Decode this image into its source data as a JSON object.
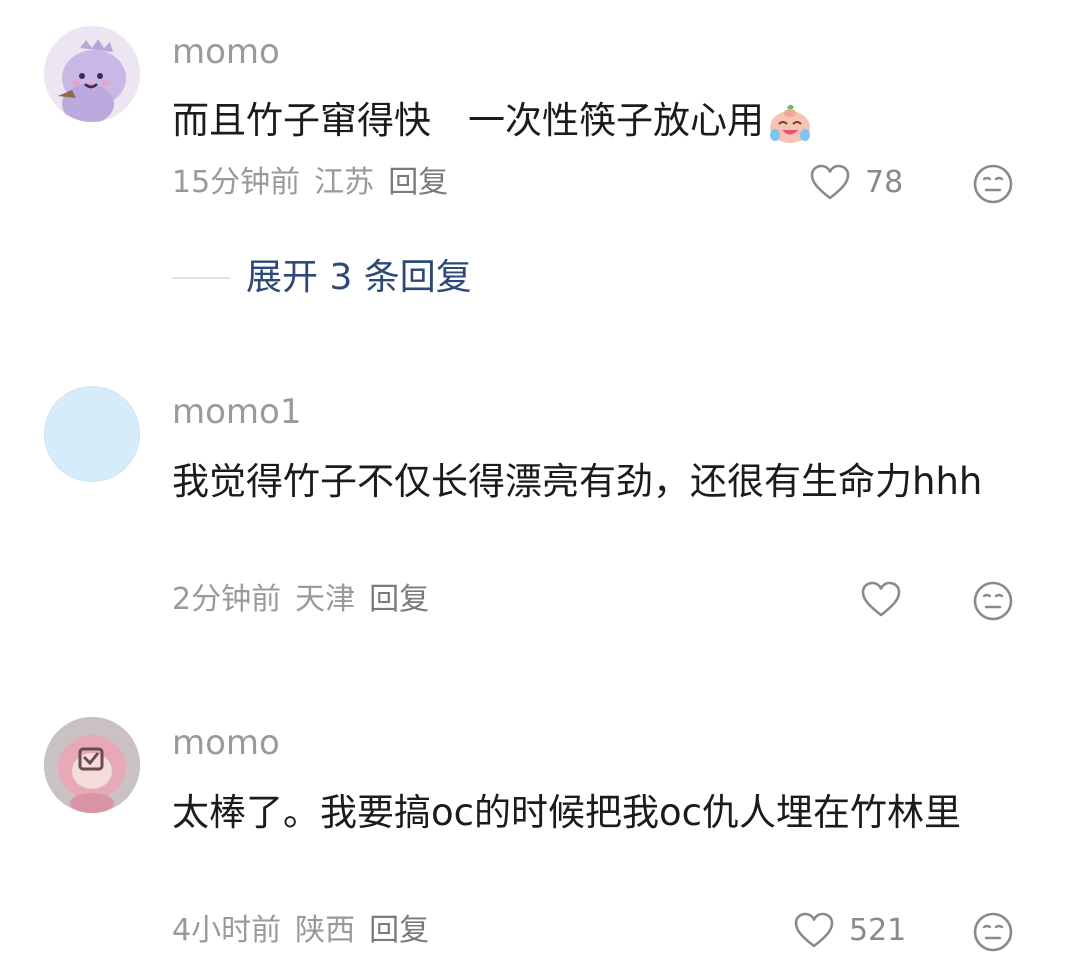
{
  "comments": [
    {
      "username": "momo",
      "text_before": "而且竹子窜得快　一次性筷子放心用",
      "emoji": "crying-laughing-face-emoji",
      "time": "15分钟前",
      "location": "江苏",
      "reply_label": "回复",
      "likes": "78",
      "avatar": "purple-plush-dinosaur"
    },
    {
      "username": "momo1",
      "text": "我觉得竹子不仅长得漂亮有劲，还很有生命力hhh",
      "time": "2分钟前",
      "location": "天津",
      "reply_label": "回复",
      "likes": "",
      "avatar": "light-blue-blank"
    },
    {
      "username": "momo",
      "text": "太棒了。我要搞oc的时候把我oc仇人埋在竹林里",
      "time": "4小时前",
      "location": "陕西",
      "reply_label": "回复",
      "likes": "521",
      "avatar": "pink-anime-doll"
    }
  ],
  "expand_replies": {
    "label": "展开 3 条回复"
  },
  "colors": {
    "meta": "#9a9a9a",
    "text": "#1b1b1b",
    "expand": "#2d4a77"
  }
}
